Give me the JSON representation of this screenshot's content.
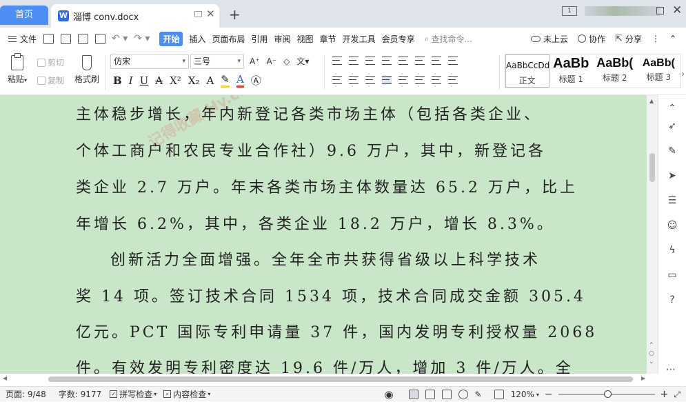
{
  "tabs": {
    "home": "首页",
    "document": "淄博 conv.docx"
  },
  "menu": {
    "file": "文件",
    "start": "开始",
    "items": [
      "插入",
      "页面布局",
      "引用",
      "审阅",
      "视图",
      "章节",
      "开发工具",
      "会员专享"
    ],
    "search_placeholder": "查找命令...",
    "cloud": "未上云",
    "collab": "协作",
    "share": "分享"
  },
  "ribbon": {
    "paste": "粘贴",
    "cut": "剪切",
    "copy": "复制",
    "format_painter": "格式刷",
    "font_name": "仿宋",
    "font_size": "三号",
    "styles": [
      {
        "sample": "AaBbCcDd",
        "name": "正文"
      },
      {
        "sample": "AaBb",
        "name": "标题 1"
      },
      {
        "sample": "AaBb(",
        "name": "标题 2"
      },
      {
        "sample": "AaBb(",
        "name": "标题 3"
      }
    ]
  },
  "document": {
    "lines": [
      "主体稳步增长，年内新登记各类市场主体（包括各类企业、",
      "个体工商户和农民专业合作社）9.6 万户，其中，新登记各",
      "类企业  2.7 万户。年末各类市场主体数量达  65.2 万户，比上",
      "年增长  6.2%，其中，各类企业  18.2 万户，增长  8.3%。",
      "创新活力全面增强。全年全市共获得省级以上科学技术",
      "奖  14 项。签订技术合同  1534 项，技术合同成交金额  305.4",
      "亿元。PCT 国际专利申请量  37 件，国内发明专利授权量  2068",
      "件。有效发明专利密度达  19.6 件/万人，增加  3 件/万人。全"
    ],
    "watermark": "记得收藏 Hy.cn"
  },
  "status": {
    "page": "页面: 9/48",
    "words": "字数: 9177",
    "spell": "拼写检查",
    "content": "内容检查",
    "zoom": "120%"
  }
}
